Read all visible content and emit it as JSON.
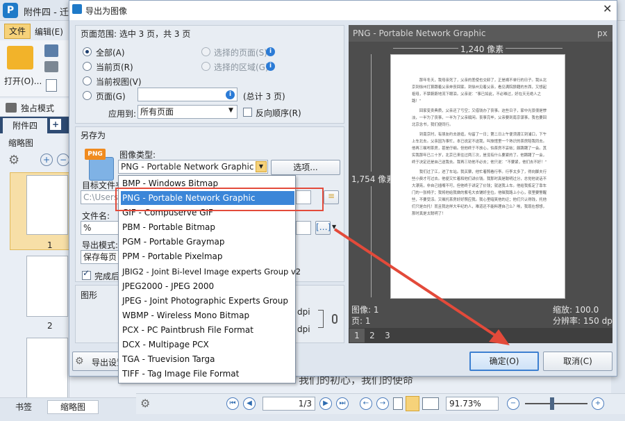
{
  "app": {
    "logo": "P",
    "title": "附件四 - 迁"
  },
  "menus": {
    "file": "文件",
    "edit": "编辑(E)"
  },
  "ribbon": {
    "open": "打开(O)...",
    "mode": "独占模式"
  },
  "doc_tab": {
    "name": "附件四",
    "plus": "+"
  },
  "thumb_panel": {
    "label": "缩略图",
    "page1": "1",
    "page2": "2"
  },
  "bottom_tabs": {
    "bookmark": "书签",
    "thumbnails": "缩略图"
  },
  "status": {
    "page": "1/3",
    "zoom": "91.73%"
  },
  "bg_doc_text": "我们的初心，我们的使命",
  "dialog": {
    "title": "导出为图像",
    "close": "✕",
    "range": {
      "label": "页面范围: 选中 3 页，共 3 页",
      "all": "全部(A)",
      "current": "当前页(R)",
      "current_view": "当前视图(V)",
      "pages": "页面(G)",
      "selected_pages": "选择的页面(S)",
      "selected_area": "选择的区域(G)",
      "total": "(总计 3 页)",
      "apply_label": "应用到:",
      "apply_value": "所有页面",
      "reverse": "反向顺序(R)"
    },
    "save_as": {
      "label": "另存为",
      "image_type_label": "图像类型:",
      "image_type_value": "PNG - Portable Network Graphic",
      "options_button": "选项...",
      "target_folder_label": "目标文件夹",
      "target_folder_value": "C:\\Users\\",
      "file_name_label": "文件名:",
      "file_name_value": "%[FileNam",
      "export_mode_label": "导出模式:",
      "export_mode_value": "保存每页至",
      "finish_label": "完成后打"
    },
    "graphic": {
      "label": "图形",
      "dpi1": "dpi",
      "dpi2": "dpi"
    },
    "preview": {
      "title": "PNG - Portable Network Graphic",
      "unit": "px",
      "width": "1,240 像素",
      "height": "1,754 像素",
      "image": "图像: 1",
      "page": "页: 1",
      "zoom": "缩放: 100.0",
      "resolution": "分辨率: 150 dpi",
      "tabs": [
        "1",
        "2",
        "3"
      ],
      "paragraphs": [
        "那年冬天，我母亲死了，父亲的差使也交卸了，正是祸不单行的日子。我从北京到徐州打算跟着父亲奔丧回家。到徐州见着父亲，看见满院狼藉的东西，又想起祖母，不禁簌簌地流下眼泪。父亲说：“事已如此，不必难过，好在天无绝人之路！”",
        "回家变卖典质，父亲还了亏空；又借钱办了丧事。这些日子，家中光景很是惨淡，一半为了丧事，一半为了父亲赋闲。丧事完毕，父亲要到南京谋事，我也要回北京念书，我们便同行。",
        "到南京时，有朋友约去游逛，勾留了一日；第二日上午便须渡江到浦口，下午上车北去。父亲因为事忙，本已说定不送我，叫旅馆里一个熟识的茶房陪我同去。他再三嘱咐茶房，甚是仔细。但他终于不放心，怕茶房不妥帖；颇踌躇了一会。其实我那年已二十岁，北京已来往过两三次，是没有什么要紧的了。他踌躇了一会，终于决定还是自己送我去。我再三劝他不必去；他只说：“不要紧，他们去不好！”",
        "我们过了江，进了车站。我买票，他忙着照看行李。行李太多了，得向脚夫行些小费才可过去。他便又忙着和他们讲价钱。我那时真是聪明过分，总觉他说话不大漂亮，非自己插嘴不可，但他终于讲定了价钱；就送我上车。他给我拣定了靠车门的一张椅子；我将他给我做的紫毛大衣铺好坐位。他嘱我路上小心，夜里要警醒些，不要受凉。又嘱托茶房好好照应我。我心里暗笑他的迂；他们只认得钱，托他们只是白托！而且我这样大年纪的人，难道还不能料理自己么？唉，我现在想想，那时真是太聪明了！"
      ]
    },
    "footer": {
      "settings": "导出设置",
      "ok": "确定(O)",
      "cancel": "取消(C)"
    },
    "dropdown": {
      "items": [
        "BMP - Windows Bitmap",
        "PNG - Portable Network Graphic",
        "GIF - Compuserve GIF",
        "PBM - Portable Bitmap",
        "PGM - Portable Graymap",
        "PPM - Portable Pixelmap",
        "JBIG2 - Joint Bi-level Image experts Group v2",
        "JPEG2000 - JPEG 2000",
        "JPEG - Joint Photographic Experts Group",
        "WBMP - Wireless Mono Bitmap",
        "PCX - PC Paintbrush File Format",
        "DCX - Multipage PCX",
        "TGA - Truevision Targa",
        "TIFF - Tag Image File Format"
      ],
      "selected_index": 1
    }
  },
  "colors": {
    "highlight": "#3b86d8",
    "annotation": "#e34a3a",
    "app_accent": "#1f7ac8"
  }
}
